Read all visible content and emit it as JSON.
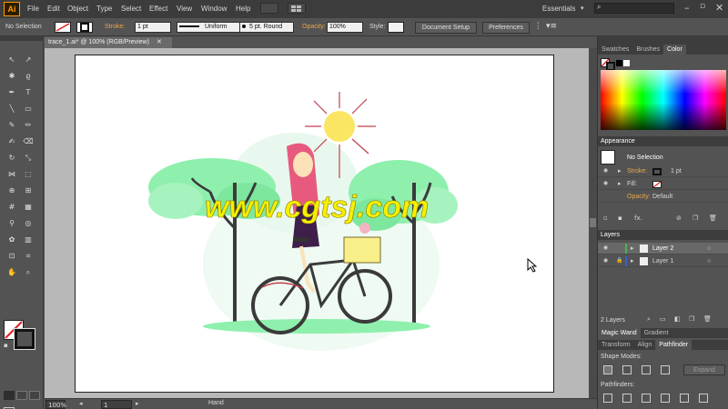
{
  "app": {
    "logo": "Ai"
  },
  "menu": [
    "File",
    "Edit",
    "Object",
    "Type",
    "Select",
    "Effect",
    "View",
    "Window",
    "Help"
  ],
  "workspace": "Essentials",
  "control": {
    "selection": "No Selection",
    "stroke_label": "Stroke:",
    "stroke_weight": "1 pt",
    "profile": "Uniform",
    "brush": "5 pt. Round",
    "opacity_label": "Opacity:",
    "opacity_value": "100%",
    "style_label": "Style:",
    "document_setup": "Document Setup",
    "preferences": "Preferences"
  },
  "document_tab": "trace_1.ai* @ 100% (RGB/Preview)",
  "watermark": "www.cgtsj.com",
  "statusbar": {
    "zoom": "100%",
    "page": "1",
    "tool": "Hand"
  },
  "color_panel": {
    "tabs": [
      "Swatches",
      "Brushes",
      "Color"
    ],
    "active": "Color"
  },
  "appearance": {
    "title": "Appearance",
    "selection": "No Selection",
    "stroke_label": "Stroke:",
    "stroke_value": "1 pt",
    "fill_label": "Fill:",
    "opacity_label": "Opacity:",
    "opacity_value": "Default"
  },
  "layers": {
    "title": "Layers",
    "items": [
      {
        "name": "Layer 2",
        "color": "#4caf50"
      },
      {
        "name": "Layer 1",
        "color": "#3a5fcd"
      }
    ],
    "count": "2 Layers"
  },
  "magic_wand": {
    "tabs": [
      "Magic Wand",
      "Gradient"
    ]
  },
  "pathfinder": {
    "tabs": [
      "Transform",
      "Align",
      "Pathfinder"
    ],
    "active": "Pathfinder",
    "shape_modes": "Shape Modes:",
    "expand": "Expand",
    "pathfinders": "Pathfinders:"
  }
}
